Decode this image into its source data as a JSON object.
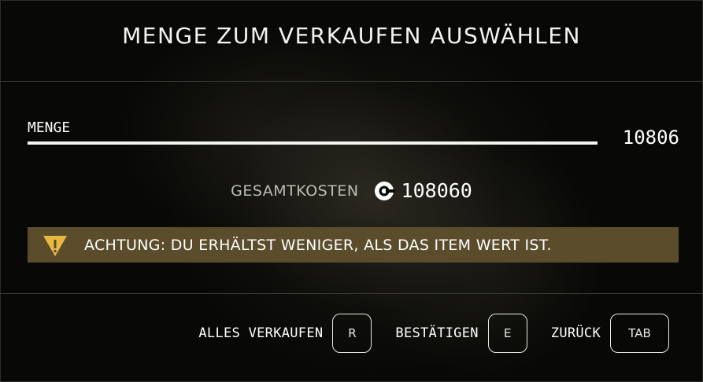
{
  "dialog": {
    "title": "MENGE ZUM VERKAUFEN AUSWÄHLEN"
  },
  "quantity": {
    "label": "MENGE",
    "value": "10806",
    "slider_fraction": 1.0
  },
  "total": {
    "label": "GESAMTKOSTEN",
    "value": "108060",
    "icon": "credits-icon"
  },
  "warning": {
    "icon": "warning-triangle-icon",
    "text": "ACHTUNG: DU ERHÄLTST WENIGER, ALS DAS ITEM WERT IST."
  },
  "footer": {
    "actions": [
      {
        "label": "ALLES VERKAUFEN",
        "key": "R"
      },
      {
        "label": "BESTÄTIGEN",
        "key": "E"
      },
      {
        "label": "ZURÜCK",
        "key": "TAB"
      }
    ]
  },
  "colors": {
    "warning_bg": "#5b4c2c",
    "warning_icon": "#e8b840",
    "text": "#ffffff"
  }
}
